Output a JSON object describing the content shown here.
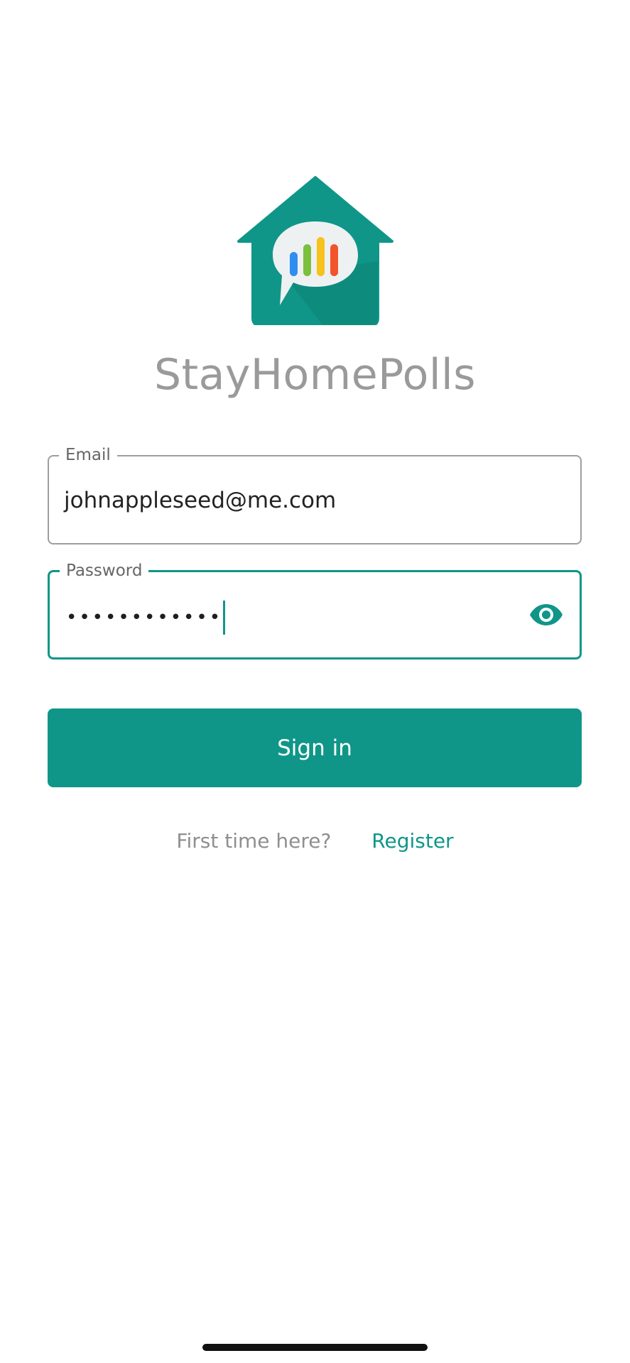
{
  "app": {
    "name": "StayHomePolls"
  },
  "logo": {
    "icon": "house-chat-poll-icon",
    "house_color": "#0f9688",
    "bubble_color": "#eef1f2",
    "bar_colors": [
      "#2f8ef0",
      "#7cbf3d",
      "#f6c21b",
      "#f2532b"
    ]
  },
  "form": {
    "email": {
      "label": "Email",
      "value": "johnappleseed@me.com"
    },
    "password": {
      "label": "Password",
      "masked_value": "••••••••••••",
      "toggle_icon": "eye-icon"
    },
    "signin_label": "Sign in"
  },
  "footer": {
    "prompt": "First time here?",
    "register_label": "Register"
  },
  "colors": {
    "accent": "#0f9688",
    "title_gray": "#9a9a9a"
  }
}
